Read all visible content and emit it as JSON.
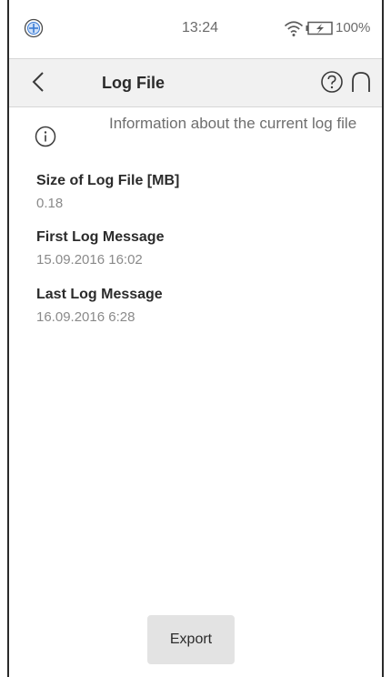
{
  "status_bar": {
    "logo_icon": "app-logo-icon",
    "time": "13:24",
    "wifi_icon": "wifi-icon",
    "battery_icon": "battery-charging-icon",
    "battery_percent": "100%"
  },
  "header": {
    "back_icon": "chevron-left-icon",
    "title": "Log File",
    "help_icon": "help-circle-icon",
    "home_icon": "home-arch-icon"
  },
  "info": {
    "icon": "info-circle-icon",
    "text": "Information about the current log file"
  },
  "fields": [
    {
      "label": "Size of Log File [MB]",
      "value": "0.18"
    },
    {
      "label": "First Log Message",
      "value": "15.09.2016 16:02"
    },
    {
      "label": "Last Log Message",
      "value": "16.09.2016 6:28"
    }
  ],
  "actions": {
    "export_label": "Export"
  },
  "colors": {
    "header_bg": "#f1f1f1",
    "button_bg": "#e3e3e3",
    "muted_text": "#8a8a8a",
    "accent_logo": "#3a7bd5"
  }
}
